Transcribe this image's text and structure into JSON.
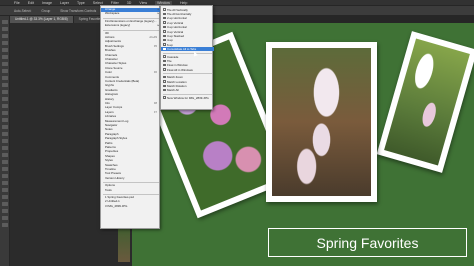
{
  "menubar": [
    "File",
    "Edit",
    "Image",
    "Layer",
    "Type",
    "Select",
    "Filter",
    "3D",
    "View",
    "Window",
    "Help"
  ],
  "menubar_active_index": 9,
  "options": [
    "Auto-Select:",
    "Group",
    "Show Transform Controls"
  ],
  "tabs": [
    {
      "label": "Untitled-1 @ 33.3% (Layer 1, RGB/8)",
      "active": true
    },
    {
      "label": "Spring Favorites.psd",
      "active": false
    },
    {
      "label": "IMG_2839.JPG @ 33.3%",
      "active": false
    }
  ],
  "banner": {
    "title": "Spring Favorites"
  },
  "window_menu": {
    "items": [
      {
        "label": "Arrange",
        "type": "submenu",
        "selected": true
      },
      {
        "label": "Workspace",
        "type": "submenu"
      },
      {
        "type": "sep"
      },
      {
        "label": "Find Extensions on Exchange (legacy)..."
      },
      {
        "label": "Extensions (legacy)",
        "type": "submenu"
      },
      {
        "type": "sep"
      },
      {
        "label": "3D"
      },
      {
        "label": "Actions",
        "shortcut": "Alt+F9"
      },
      {
        "label": "Adjustments"
      },
      {
        "label": "Brush Settings",
        "shortcut": "F5"
      },
      {
        "label": "Brushes"
      },
      {
        "label": "Channels"
      },
      {
        "label": "Character"
      },
      {
        "label": "Character Styles"
      },
      {
        "label": "Clone Source"
      },
      {
        "label": "Color",
        "shortcut": "F6"
      },
      {
        "label": "Comments"
      },
      {
        "label": "Content Credentials (Beta)"
      },
      {
        "label": "Glyphs"
      },
      {
        "label": "Gradients"
      },
      {
        "label": "Histogram"
      },
      {
        "label": "History"
      },
      {
        "label": "Info",
        "shortcut": "F8"
      },
      {
        "label": "Layer Comps"
      },
      {
        "label": "Layers",
        "shortcut": "F7"
      },
      {
        "label": "Libraries"
      },
      {
        "label": "Measurement Log"
      },
      {
        "label": "Navigator"
      },
      {
        "label": "Notes"
      },
      {
        "label": "Paragraph"
      },
      {
        "label": "Paragraph Styles"
      },
      {
        "label": "Paths"
      },
      {
        "label": "Patterns"
      },
      {
        "label": "Properties"
      },
      {
        "label": "Shapes"
      },
      {
        "label": "Styles"
      },
      {
        "label": "Swatches"
      },
      {
        "label": "Timeline"
      },
      {
        "label": "Tool Presets"
      },
      {
        "label": "Version History"
      },
      {
        "type": "sep"
      },
      {
        "label": "Options"
      },
      {
        "label": "Tools"
      },
      {
        "type": "sep"
      },
      {
        "label": "1 Spring Favorites.psd"
      },
      {
        "label": "2 Untitled-1"
      },
      {
        "label": "3 IMG_2839.JPG"
      }
    ]
  },
  "arrange_menu": {
    "items": [
      {
        "label": "Tile All Vertically"
      },
      {
        "label": "Tile All Horizontally"
      },
      {
        "label": "2-up Horizontal"
      },
      {
        "label": "2-up Vertical"
      },
      {
        "label": "3-up Horizontal"
      },
      {
        "label": "3-up Vertical"
      },
      {
        "label": "3-up Stacked"
      },
      {
        "label": "4-up"
      },
      {
        "label": "6-up"
      },
      {
        "label": "Consolidate All to Tabs",
        "selected": true
      },
      {
        "type": "sep"
      },
      {
        "label": "Cascade"
      },
      {
        "label": "Tile"
      },
      {
        "label": "Float in Window"
      },
      {
        "label": "Float All in Windows"
      },
      {
        "type": "sep"
      },
      {
        "label": "Match Zoom"
      },
      {
        "label": "Match Location"
      },
      {
        "label": "Match Rotation"
      },
      {
        "label": "Match All"
      },
      {
        "type": "sep"
      },
      {
        "label": "New Window for IMG_2839.JPG"
      }
    ]
  }
}
